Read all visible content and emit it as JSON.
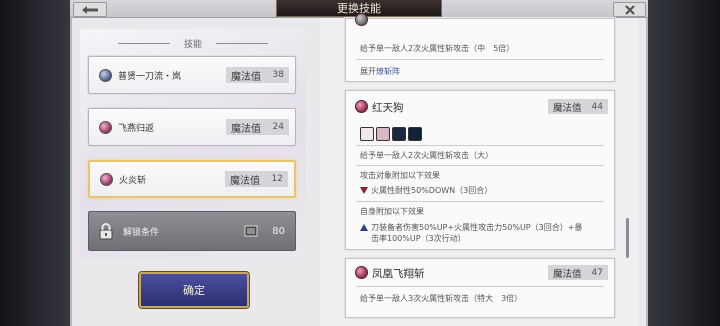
{
  "header": {
    "title": "更换技能",
    "back_icon": "back-arrow-icon",
    "close_icon": "close-icon"
  },
  "left": {
    "section_title": "技能",
    "skills": [
      {
        "name": "普贤一刀流・岚",
        "mp_label": "魔法值",
        "mp": "38",
        "icon_color": "#5a6a9a",
        "selected": false
      },
      {
        "name": "飞燕归返",
        "mp_label": "魔法值",
        "mp": "24",
        "icon_color": "#a24a74",
        "selected": false
      },
      {
        "name": "火炎斩",
        "mp_label": "魔法值",
        "mp": "12",
        "icon_color": "#b2487a",
        "selected": true
      }
    ],
    "unlock": {
      "label": "解锁条件",
      "value": "80"
    },
    "confirm_label": "确定"
  },
  "right": {
    "card_top": {
      "desc": "给予单一敌人2次火属性斩攻击（中　5倍）",
      "expand_prefix": "展开",
      "expand_link": "燎斩阵"
    },
    "card_main": {
      "name": "红天狗",
      "mp_label": "魔法值",
      "mp": "44",
      "desc": "给予单一敌人2次火属性斩攻击（大）",
      "target_effect_title": "攻击对象附加以下效果",
      "target_effect": "火属性耐性50%DOWN（3回合）",
      "self_effect_title": "自身附加以下效果",
      "self_effect_line1": "刀装备者伤害50%UP+火属性攻击力50%UP（3回合）+暴",
      "self_effect_line2": "击率100%UP（3次行动）"
    },
    "card_bottom": {
      "name": "凤凰飞翔斩",
      "mp_label": "魔法值",
      "mp": "47",
      "desc": "给予单一敌人3次火属性斩攻击（特大　3倍）"
    }
  },
  "colors": {
    "accent_gold": "#e7c56d",
    "confirm_blue": "#3a3e86",
    "link_blue": "#3a58a8"
  }
}
